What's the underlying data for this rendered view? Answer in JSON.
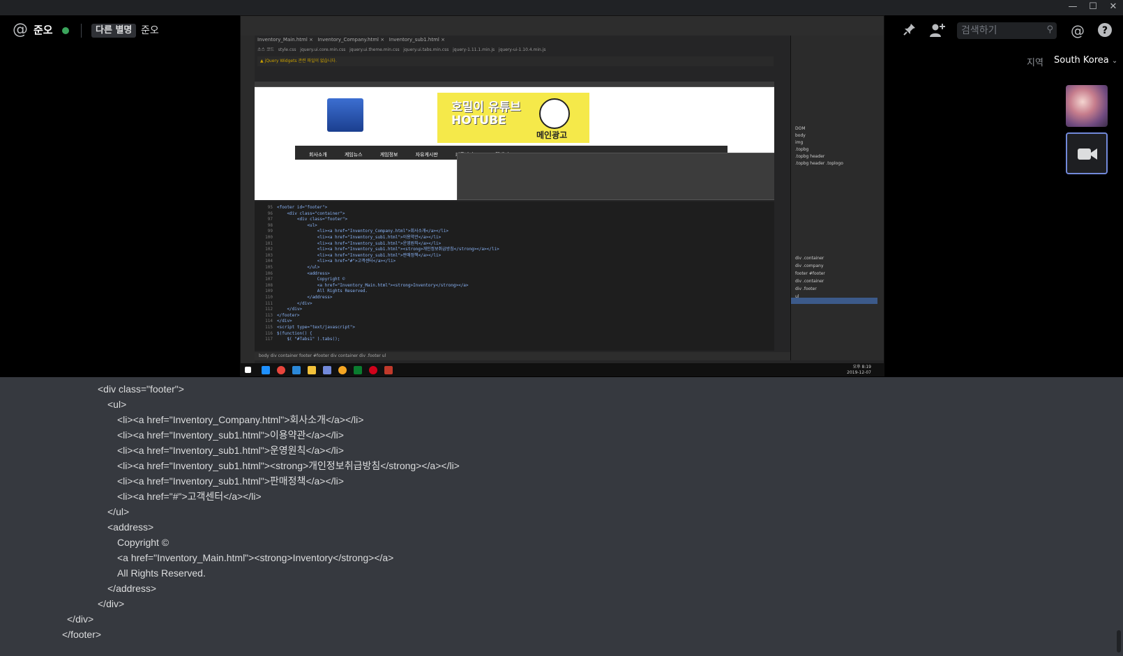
{
  "header": {
    "user": "준오",
    "nickname_tag": "다른 별명",
    "nickname": "준오",
    "search_placeholder": "검색하기",
    "region_label": "지역",
    "region_value": "South Korea"
  },
  "colors": {
    "online": "#3ba55c",
    "accent": "#7289da",
    "code_bg": "#36393f",
    "stage_bg": "#000000"
  },
  "icons": [
    "at-icon",
    "pin-icon",
    "add-friend-icon",
    "search-icon",
    "mention-icon",
    "help-icon",
    "chevron-down-icon",
    "minimize-icon",
    "maximize-icon",
    "close-icon"
  ],
  "window": {
    "minimize": "—",
    "maximize": "☐",
    "close": "✕"
  },
  "screenshare": {
    "banner_title": "호밀이 유튜브\nHOTUBE",
    "banner_ad": "메인광고",
    "nav": [
      "회사소개",
      "게임뉴스",
      "게임정보",
      "자유게시판",
      "커뮤니티",
      "고객센터"
    ],
    "status": "body  div  container  footer  #footer  div  container  div  .footer  ul",
    "mode": "HTML",
    "code_lines": [
      {
        "n": "95",
        "t": "<footer id=\"footer\">"
      },
      {
        "n": "96",
        "t": "    <div class=\"container\">"
      },
      {
        "n": "97",
        "t": "        <div class=\"footer\">"
      },
      {
        "n": "98",
        "t": "            <ul>"
      },
      {
        "n": "99",
        "t": "                <li><a href=\"Inventory_Company.html\">회사소개</a></li>"
      },
      {
        "n": "100",
        "t": "                <li><a href=\"Inventory_sub1.html\">이용약관</a></li>"
      },
      {
        "n": "101",
        "t": "                <li><a href=\"Inventory_sub1.html\">운영원칙</a></li>"
      },
      {
        "n": "102",
        "t": "                <li><a href=\"Inventory_sub1.html\"><strong>개인정보취급방침</strong></a></li>"
      },
      {
        "n": "103",
        "t": "                <li><a href=\"Inventory_sub1.html\">판매정책</a></li>"
      },
      {
        "n": "104",
        "t": "                <li><a href=\"#\">고객센터</a></li>"
      },
      {
        "n": "105",
        "t": "            </ul>"
      },
      {
        "n": "106",
        "t": "            <address>"
      },
      {
        "n": "107",
        "t": "                Copyright ©"
      },
      {
        "n": "108",
        "t": "                <a href=\"Inventory_Main.html\"><strong>Inventory</strong></a>"
      },
      {
        "n": "109",
        "t": "                All Rights Reserved."
      },
      {
        "n": "110",
        "t": "            </address>"
      },
      {
        "n": "111",
        "t": "        </div>"
      },
      {
        "n": "112",
        "t": "    </div>"
      },
      {
        "n": "113",
        "t": "</footer>"
      },
      {
        "n": "114",
        "t": "</div>"
      },
      {
        "n": "115",
        "t": "<script type=\"text/javascript\">"
      },
      {
        "n": "116",
        "t": "$(function() {"
      },
      {
        "n": "117",
        "t": "    $( \"#Tabs1\" ).tabs();"
      }
    ],
    "dom_items": [
      "DOM",
      "body",
      "img",
      ".topbg",
      ".topbg header",
      ".topbg header .toplogo",
      "div .container",
      "div .company",
      "footer #footer",
      "div .container",
      "div .footer",
      "ul"
    ],
    "taskbar_time": "오후 8:19\n2019-12-07"
  },
  "code_panel": {
    "lines": [
      "<div class=\"footer\">",
      "<ul>",
      "<li><a href=\"Inventory_Company.html\">회사소개</a></li>",
      "<li><a href=\"Inventory_sub1.html\">이용약관</a></li>",
      "<li><a href=\"Inventory_sub1.html\">운영원칙</a></li>",
      "<li><a href=\"Inventory_sub1.html\"><strong>개인정보취급방침</strong></a></li>",
      "<li><a href=\"Inventory_sub1.html\">판매정책</a></li>",
      "<li><a href=\"#\">고객센터</a></li>",
      "</ul>",
      "<address>",
      "Copyright ©",
      "<a href=\"Inventory_Main.html\"><strong>Inventory</strong></a>",
      "All Rights Reserved.",
      "</address>",
      "</div>",
      "</div>",
      "</footer>"
    ]
  }
}
